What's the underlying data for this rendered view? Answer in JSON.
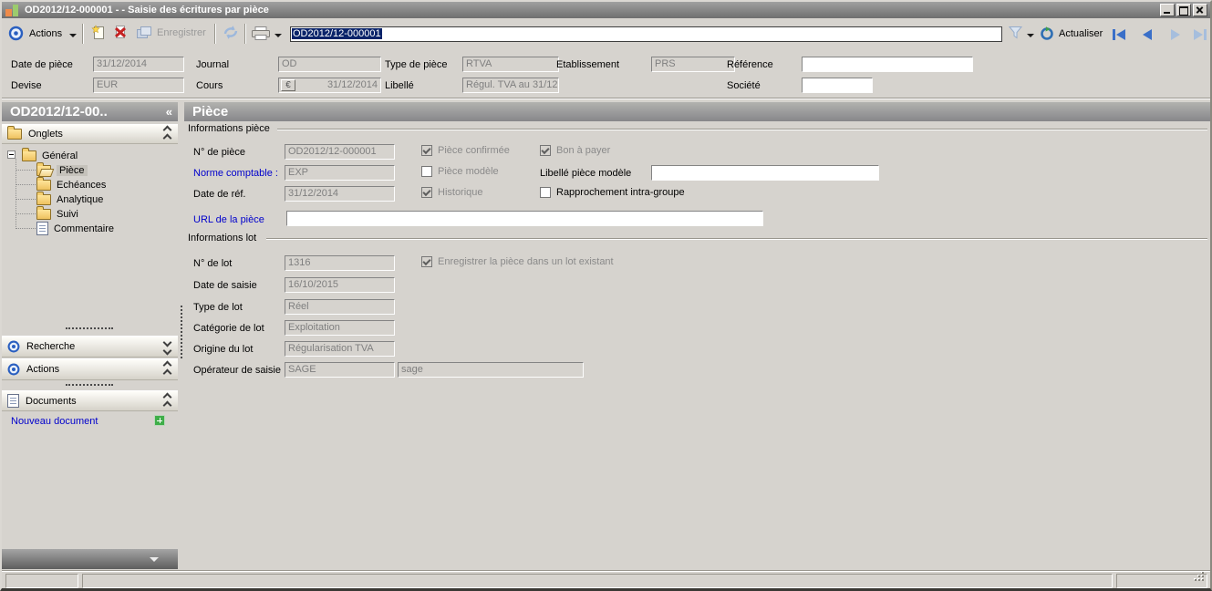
{
  "window": {
    "title": "OD2012/12-000001 - - Saisie des écritures par pièce"
  },
  "toolbar": {
    "actions_label": "Actions",
    "save_label": "Enregistrer",
    "document_number": "OD2012/12-000001",
    "refresh_label": "Actualiser"
  },
  "header": {
    "fields": [
      {
        "label": "Date de pièce",
        "value": "31/12/2014"
      },
      {
        "label": "Journal",
        "value": "OD"
      },
      {
        "label": "Type de pièce",
        "value": "RTVA"
      },
      {
        "label": "Etablissement",
        "value": "PRS"
      },
      {
        "label": "Référence",
        "value": ""
      },
      {
        "label": "Devise",
        "value": "EUR"
      },
      {
        "label": "Cours",
        "value": "31/12/2014"
      },
      {
        "label": "Libellé",
        "value": "Régul. TVA au 31/12"
      },
      {
        "label": "Société",
        "value": ""
      }
    ]
  },
  "sidebar": {
    "panel_title": "OD2012/12-00..",
    "onglets_label": "Onglets",
    "tree_root": "Général",
    "tree_items": [
      "Pièce",
      "Echéances",
      "Analytique",
      "Suivi",
      "Commentaire"
    ],
    "selected_tree_item": "Pièce",
    "recherche_label": "Recherche",
    "actions_label": "Actions",
    "documents_label": "Documents",
    "new_document_label": "Nouveau document"
  },
  "main": {
    "panel_title": "Pièce",
    "info_piece": {
      "legend": "Informations pièce",
      "num_label": "N° de pièce",
      "num_value": "OD2012/12-000001",
      "cb_confirmee": {
        "label": "Pièce confirmée",
        "checked": true
      },
      "cb_bon": {
        "label": "Bon à payer",
        "checked": true
      },
      "norme_label": "Norme comptable :",
      "norme_value": "EXP",
      "cb_modele": {
        "label": "Pièce modèle",
        "checked": false
      },
      "libelle_modele_label": "Libellé pièce modèle",
      "libelle_modele_value": "",
      "dateref_label": "Date de réf.",
      "dateref_value": "31/12/2014",
      "cb_historique": {
        "label": "Historique",
        "checked": true
      },
      "cb_rapprochement": {
        "label": "Rapprochement intra-groupe",
        "checked": false
      },
      "url_label": "URL de la pièce",
      "url_value": ""
    },
    "info_lot": {
      "legend": "Informations lot",
      "lot_label": "N° de lot",
      "lot_value": "1316",
      "cb_lot": {
        "label": "Enregistrer la pièce dans un lot existant",
        "checked": true
      },
      "saisie_label": "Date de saisie",
      "saisie_value": "16/10/2015",
      "type_label": "Type de lot",
      "type_value": "Réel",
      "categorie_label": "Catégorie de lot",
      "categorie_value": "Exploitation",
      "origine_label": "Origine du lot",
      "origine_value": "Régularisation TVA",
      "operateur_label": "Opérateur de saisie",
      "operateur_value": "SAGE",
      "operateur_value2": "sage"
    }
  },
  "icons": {
    "euro": "€",
    "collapse_left": "«"
  },
  "colors": {
    "selection": "#0a246a",
    "link": "#0000cc",
    "window_bg": "#d6d3ce",
    "titlebar_gray": "#8a8a8a"
  }
}
